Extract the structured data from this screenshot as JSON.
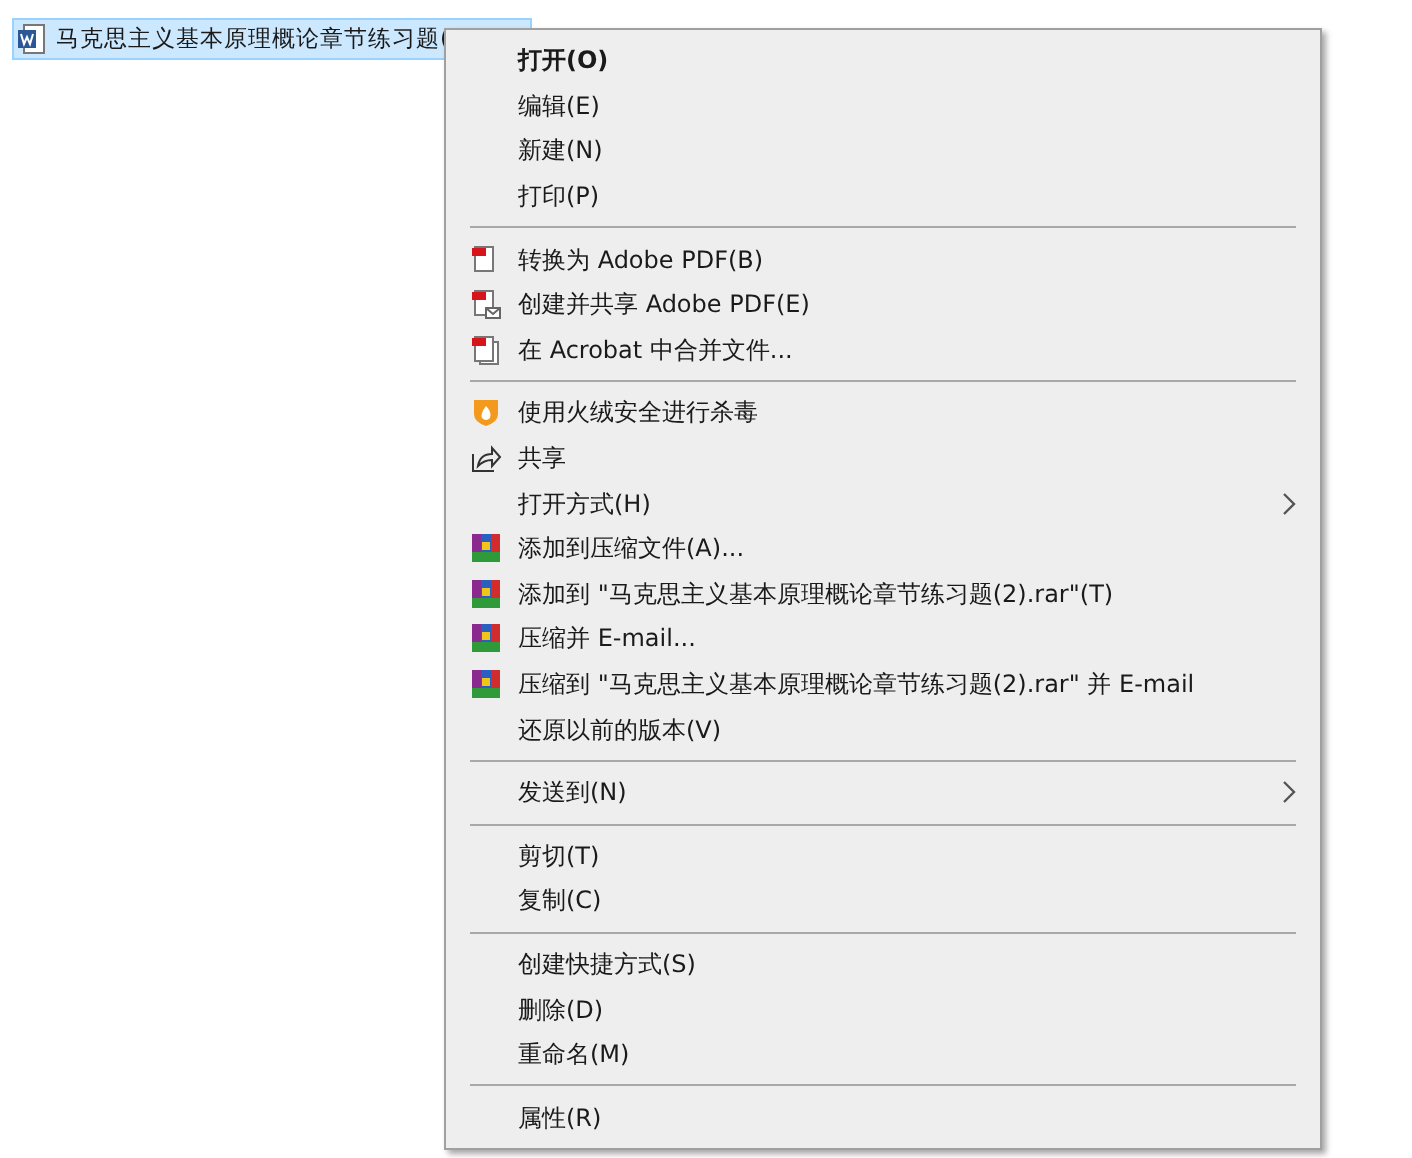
{
  "file_row": {
    "name": "马克思主义基本原理概论章节练习题(",
    "selected": true
  },
  "context_menu": {
    "sections": [
      {
        "items": [
          {
            "label": "打开(O)",
            "kind": "plain",
            "default": true,
            "submenu": false
          },
          {
            "label": "编辑(E)",
            "kind": "plain",
            "default": false,
            "submenu": false
          },
          {
            "label": "新建(N)",
            "kind": "plain",
            "default": false,
            "submenu": false
          },
          {
            "label": "打印(P)",
            "kind": "plain",
            "default": false,
            "submenu": false
          }
        ]
      },
      {
        "items": [
          {
            "label": "转换为 Adobe PDF(B)",
            "kind": "pdf",
            "default": false,
            "submenu": false
          },
          {
            "label": "创建并共享 Adobe PDF(E)",
            "kind": "pdf-mail",
            "default": false,
            "submenu": false
          },
          {
            "label": "在 Acrobat 中合并文件...",
            "kind": "pdf-merge",
            "default": false,
            "submenu": false
          }
        ]
      },
      {
        "items": [
          {
            "label": "使用火绒安全进行杀毒",
            "kind": "shield",
            "default": false,
            "submenu": false
          },
          {
            "label": "共享",
            "kind": "share",
            "default": false,
            "submenu": false
          },
          {
            "label": "打开方式(H)",
            "kind": "plain",
            "default": false,
            "submenu": true
          },
          {
            "label": "添加到压缩文件(A)...",
            "kind": "archive",
            "default": false,
            "submenu": false
          },
          {
            "label": "添加到 \"马克思主义基本原理概论章节练习题(2).rar\"(T)",
            "kind": "archive",
            "default": false,
            "submenu": false
          },
          {
            "label": "压缩并 E-mail...",
            "kind": "archive",
            "default": false,
            "submenu": false
          },
          {
            "label": "压缩到 \"马克思主义基本原理概论章节练习题(2).rar\" 并 E-mail",
            "kind": "archive",
            "default": false,
            "submenu": false
          },
          {
            "label": "还原以前的版本(V)",
            "kind": "plain",
            "default": false,
            "submenu": false
          }
        ]
      },
      {
        "items": [
          {
            "label": "发送到(N)",
            "kind": "plain",
            "default": false,
            "submenu": true
          }
        ]
      },
      {
        "items": [
          {
            "label": "剪切(T)",
            "kind": "plain",
            "default": false,
            "submenu": false
          },
          {
            "label": "复制(C)",
            "kind": "plain",
            "default": false,
            "submenu": false
          }
        ]
      },
      {
        "items": [
          {
            "label": "创建快捷方式(S)",
            "kind": "plain",
            "default": false,
            "submenu": false
          },
          {
            "label": "删除(D)",
            "kind": "plain",
            "default": false,
            "submenu": false
          },
          {
            "label": "重命名(M)",
            "kind": "plain",
            "default": false,
            "submenu": false
          }
        ]
      },
      {
        "items": [
          {
            "label": "属性(R)",
            "kind": "plain",
            "default": false,
            "submenu": false
          }
        ]
      }
    ]
  }
}
